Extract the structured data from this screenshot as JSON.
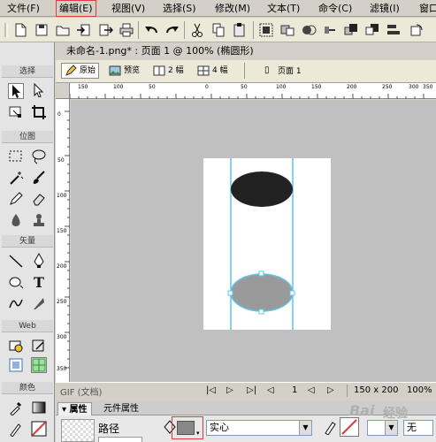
{
  "menu": {
    "items": [
      "文件(F)",
      "编辑(E)",
      "视图(V)",
      "选择(S)",
      "修改(M)",
      "文本(T)",
      "命令(C)",
      "滤镜(I)",
      "窗口"
    ],
    "active_index": 1
  },
  "document": {
    "tab_title": "未命名-1.png* : 页面 1 @ 100% (椭圆形)",
    "view_buttons": [
      "原始",
      "预览",
      "2 幅",
      "4 幅"
    ],
    "page_label": "页面 1"
  },
  "rulers": {
    "h_labels": [
      "150",
      "100",
      "50",
      "0",
      "50",
      "100",
      "150",
      "200",
      "250",
      "300",
      "350"
    ],
    "v_labels": [
      "0",
      "50",
      "100",
      "150",
      "200",
      "250",
      "300",
      "350"
    ]
  },
  "tools_panel": {
    "sections": [
      "选择",
      "位图",
      "矢量",
      "Web",
      "颜色"
    ]
  },
  "status": {
    "format_label": "GIF (文档)",
    "frame_number": "1",
    "dimensions": "150 x 200",
    "zoom": "100%"
  },
  "properties": {
    "tabs": [
      "属性",
      "元件属性"
    ],
    "object_type": "路径",
    "fill_type": "实心",
    "stroke_value": "无"
  },
  "watermark": {
    "text": "Bai",
    "suffix": "经验"
  },
  "colors": {
    "accent_highlight": "#e23b3b",
    "guide_line": "#5bc8e8",
    "ellipse_top": "#222222",
    "ellipse_bottom": "#9a9a9a",
    "selection_handle": "#ffffff"
  }
}
